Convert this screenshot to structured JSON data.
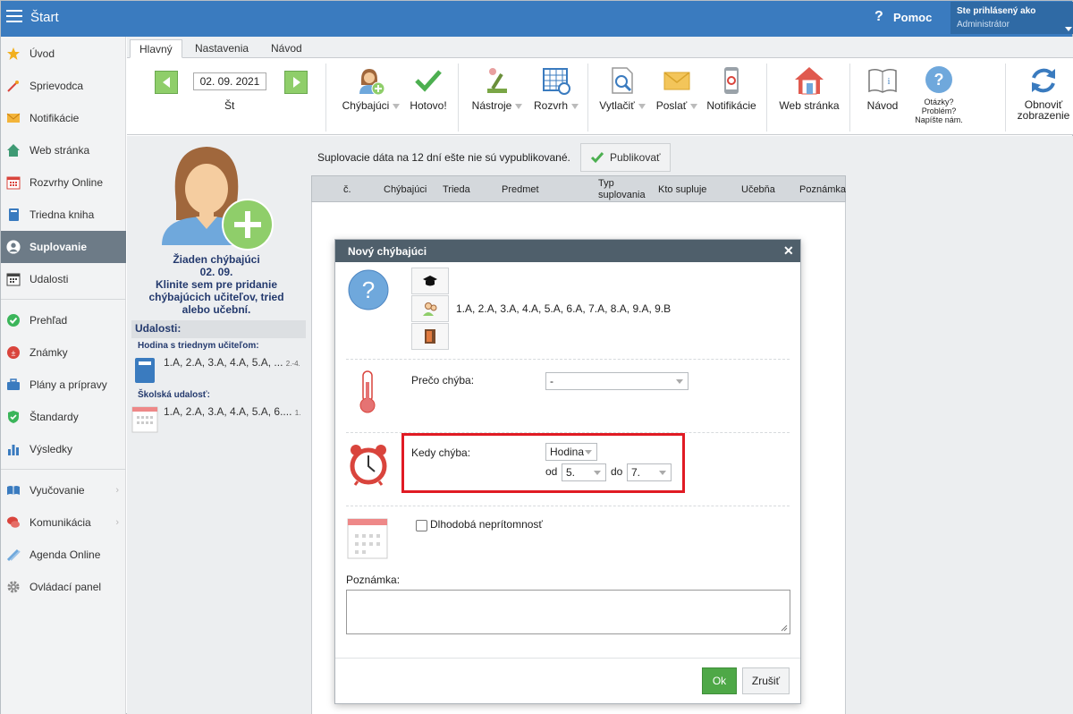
{
  "app": {
    "title": "Štart"
  },
  "header": {
    "help_label": "Pomoc",
    "user_line1": "Ste prihlásený ako",
    "user_line2": "Administrátor"
  },
  "sidebar": {
    "items": [
      {
        "label": "Úvod",
        "icon": "star-icon"
      },
      {
        "label": "Sprievodca",
        "icon": "magic-wand-icon"
      },
      {
        "label": "Notifikácie",
        "icon": "envelope-icon"
      },
      {
        "label": "Web stránka",
        "icon": "home-icon"
      },
      {
        "label": "Rozvrhy Online",
        "icon": "calendar-grid-icon"
      },
      {
        "label": "Triedna kniha",
        "icon": "book-icon"
      },
      {
        "label": "Suplovanie",
        "icon": "person-icon"
      },
      {
        "label": "Udalosti",
        "icon": "calendar-icon"
      },
      {
        "label": "Prehľad",
        "icon": "check-circle-icon"
      },
      {
        "label": "Známky",
        "icon": "grades-icon"
      },
      {
        "label": "Plány a prípravy",
        "icon": "briefcase-icon"
      },
      {
        "label": "Štandardy",
        "icon": "shield-icon"
      },
      {
        "label": "Výsledky",
        "icon": "bar-chart-icon"
      },
      {
        "label": "Vyučovanie",
        "icon": "open-book-icon"
      },
      {
        "label": "Komunikácia",
        "icon": "chat-icon"
      },
      {
        "label": "Agenda Online",
        "icon": "pencil-icon"
      },
      {
        "label": "Ovládací panel",
        "icon": "gear-icon"
      }
    ]
  },
  "tabs": [
    "Hlavný",
    "Nastavenia",
    "Návod"
  ],
  "ribbon": {
    "date": "02. 09. 2021",
    "day": "Št",
    "buttons": {
      "chybajuci": "Chýbajúci",
      "hotovo": "Hotovo!",
      "nastroje": "Nástroje",
      "rozvrh": "Rozvrh",
      "vytlacit": "Vytlačiť",
      "poslat": "Poslať",
      "notifikacie": "Notifikácie",
      "web": "Web stránka",
      "navod": "Návod",
      "otazky1": "Otázky?",
      "otazky2": "Problém?",
      "otazky3": "Napíšte nám.",
      "obnovit1": "Obnoviť",
      "obnovit2": "zobrazenie"
    }
  },
  "left_panel": {
    "empty_line1": "Žiaden chýbajúci",
    "empty_line2": "02. 09.",
    "empty_line3": "Klinite sem pre pridanie",
    "empty_line4": "chýbajúcich učiteľov, tried",
    "empty_line5": "alebo učební.",
    "events_header": "Udalosti:",
    "event1_category": "Hodina s triednym učiteľom:",
    "event1_classes": "1.A, 2.A, 3.A, 4.A, 5.A, ...",
    "event1_sup": "2.-4.",
    "event2_category": "Školská udalosť:",
    "event2_classes": "1.A, 2.A, 3.A, 4.A, 5.A, 6....",
    "event2_sup": "1."
  },
  "main": {
    "notice": "Suplovacie dáta na 12 dní ešte nie sú vypublikované.",
    "publish_label": "Publikovať",
    "columns": [
      "č.",
      "Chýbajúci",
      "Trieda",
      "Predmet",
      "Typ",
      "suplovania",
      "Kto supluje",
      "Učebňa",
      "Poznámka"
    ]
  },
  "modal": {
    "title": "Nový chýbajúci",
    "classes": "1.A, 2.A, 3.A, 4.A, 5.A, 6.A, 7.A, 8.A, 9.A, 9.B",
    "reason_label": "Prečo chýba:",
    "reason_value": "-",
    "when_label": "Kedy chýba:",
    "when_value": "Hodina",
    "from_label": "od",
    "from_value": "5.",
    "to_label": "do",
    "to_value": "7.",
    "long_term_label": "Dlhodobá neprítomnosť",
    "note_label": "Poznámka:",
    "ok_label": "Ok",
    "cancel_label": "Zrušiť"
  }
}
